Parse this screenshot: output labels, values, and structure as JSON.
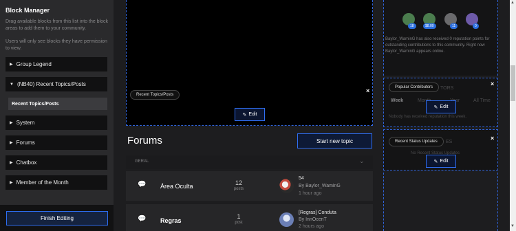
{
  "block_manager": {
    "title": "Block Manager",
    "description": "Drag available blocks from this list into the block areas to add them to your community.",
    "note": "Users will only see blocks they have permission to view.",
    "items": [
      {
        "label": "Group Legend"
      },
      {
        "label": "(NB40) Recent Topics/Posts"
      },
      {
        "label": "System"
      },
      {
        "label": "Forums"
      },
      {
        "label": "Chatbox"
      },
      {
        "label": "Member of the Month"
      }
    ],
    "expanded_sub_item": "Recent Topics/Posts",
    "finish_label": "Finish Editing"
  },
  "main": {
    "recent_block_tag": "Recent Topics/Posts",
    "edit_label": "Edit",
    "close_glyph": "×",
    "forums_title": "Forums",
    "new_topic_label": "Start new topic",
    "category_label": "GERAL",
    "forums": [
      {
        "name": "Área Oculta",
        "count": "12",
        "unit": "posts",
        "last_title": "54",
        "last_by": "By Baylor_WaminG",
        "last_time": "1 hour ago",
        "icon_color": "#6d6d70"
      },
      {
        "name": "Regras",
        "count": "1",
        "unit": "post",
        "last_title": "[Regras] Conduta",
        "last_by": "By InnOcenT",
        "last_time": "2 hours ago",
        "icon_color": "#2b6fe0"
      }
    ]
  },
  "sidebar": {
    "badges": [
      {
        "count": "18",
        "color": "#4b7d4e"
      },
      {
        "count": "$8.00",
        "color": "#4b7d4e"
      },
      {
        "count": "11",
        "color": "#6a6a6c"
      },
      {
        "count": "0",
        "color": "#6d5aa8"
      }
    ],
    "reputation_text": "Baylor_WaminG has also received 0 reputation points for outstanding contributions to this community. Right now Baylor_WaminG appears online.",
    "popular_tag": "Popular Contributors",
    "popular_heading": "TORS",
    "tabs": [
      "Week",
      "Month",
      "Year",
      "All Time"
    ],
    "popular_empty": "Nobody has received reputation this week.",
    "status_tag": "Recent Status Updates",
    "status_heading": "ES",
    "status_empty": "No Recent Status Updates",
    "edit_label": "Edit"
  },
  "colors": {
    "accent": "#2f6df0",
    "panel": "#2a2a2c",
    "background": "#1d1d1f"
  }
}
